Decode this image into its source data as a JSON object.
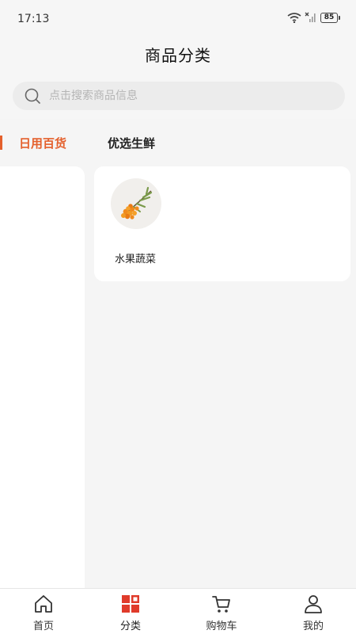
{
  "status_bar": {
    "time": "17:13",
    "battery": "85"
  },
  "header": {
    "title": "商品分类"
  },
  "search": {
    "placeholder": "点击搜索商品信息"
  },
  "tabs": [
    {
      "label": "日用百货",
      "active": true
    },
    {
      "label": "优选生鲜",
      "active": false
    }
  ],
  "categories": [
    {
      "label": "水果蔬菜",
      "icon": "sea-buckthorn-icon"
    }
  ],
  "bottom_nav": [
    {
      "label": "首页",
      "icon": "home-icon",
      "active": false
    },
    {
      "label": "分类",
      "icon": "category-icon",
      "active": true
    },
    {
      "label": "购物车",
      "icon": "cart-icon",
      "active": false
    },
    {
      "label": "我的",
      "icon": "profile-icon",
      "active": false
    }
  ],
  "colors": {
    "accent": "#e4602c",
    "category_active": "#e03b2b"
  }
}
